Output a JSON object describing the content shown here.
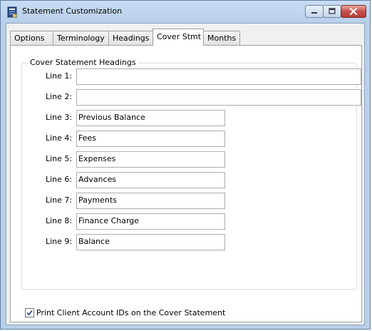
{
  "window": {
    "title": "Statement Customization",
    "icons": {
      "app": "statement-app-icon",
      "minimize": "minimize-icon",
      "maximize": "maximize-icon",
      "close": "close-icon"
    }
  },
  "tabs": [
    {
      "label": "Options",
      "active": false
    },
    {
      "label": "Terminology",
      "active": false
    },
    {
      "label": "Headings",
      "active": false
    },
    {
      "label": "Cover Stmt",
      "active": true
    },
    {
      "label": "Months",
      "active": false
    }
  ],
  "group": {
    "legend": "Cover Statement Headings",
    "lines": [
      {
        "label": "Line 1:",
        "value": ""
      },
      {
        "label": "Line 2:",
        "value": ""
      },
      {
        "label": "Line 3:",
        "value": "Previous Balance"
      },
      {
        "label": "Line 4:",
        "value": "Fees"
      },
      {
        "label": "Line 5:",
        "value": "Expenses"
      },
      {
        "label": "Line 6:",
        "value": "Advances"
      },
      {
        "label": "Line 7:",
        "value": "Payments"
      },
      {
        "label": "Line 8:",
        "value": "Finance Charge"
      },
      {
        "label": "Line 9:",
        "value": "Balance"
      }
    ]
  },
  "options": {
    "print_ids": {
      "label": "Print Client Account IDs on the Cover Statement",
      "checked": true
    }
  },
  "colors": {
    "title_gradient": "#b9d0ea",
    "close_button": "#c75050",
    "panel": "#ffffff"
  }
}
